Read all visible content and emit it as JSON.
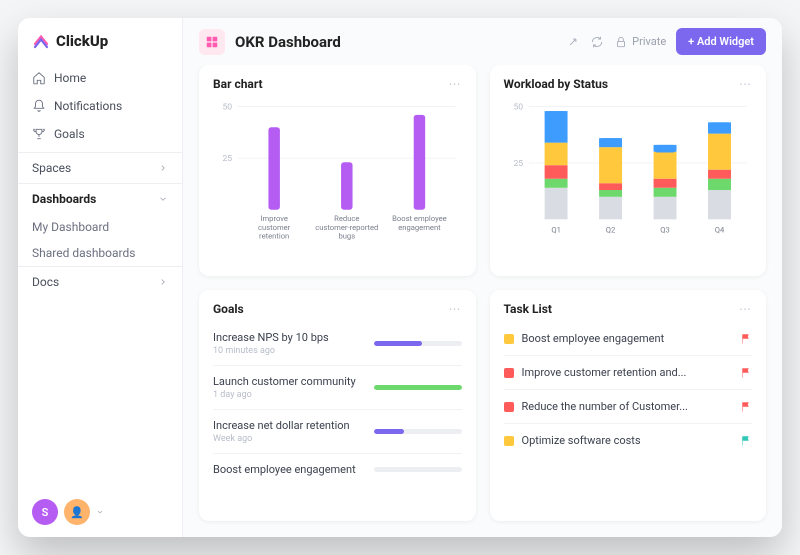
{
  "brand": "ClickUp",
  "nav": {
    "home": "Home",
    "notifications": "Notifications",
    "goals": "Goals"
  },
  "sections": {
    "spaces": "Spaces",
    "dashboards": "Dashboards",
    "my_dashboard": "My Dashboard",
    "shared_dashboards": "Shared dashboards",
    "docs": "Docs"
  },
  "header": {
    "title": "OKR Dashboard",
    "private": "Private",
    "add_widget": "+ Add Widget"
  },
  "cards": {
    "bar_chart": {
      "title": "Bar chart"
    },
    "workload": {
      "title": "Workload by Status"
    },
    "goals": {
      "title": "Goals"
    },
    "task_list": {
      "title": "Task List"
    }
  },
  "chart_data": [
    {
      "type": "bar",
      "title": "Bar chart",
      "categories": [
        "Improve customer retention",
        "Reduce customer-reported bugs",
        "Boost employee engagement"
      ],
      "values": [
        40,
        23,
        46
      ],
      "ylim": [
        0,
        50
      ],
      "yticks": [
        25,
        50
      ],
      "color": "#b55df2"
    },
    {
      "type": "stacked-bar",
      "title": "Workload by Status",
      "categories": [
        "Q1",
        "Q2",
        "Q3",
        "Q4"
      ],
      "series": [
        {
          "name": "none",
          "color": "#d9dce3",
          "values": [
            14,
            10,
            10,
            13
          ]
        },
        {
          "name": "green",
          "color": "#6dd96d",
          "values": [
            4,
            3,
            4,
            5
          ]
        },
        {
          "name": "red",
          "color": "#ff5b5b",
          "values": [
            6,
            3,
            4,
            4
          ]
        },
        {
          "name": "yellow",
          "color": "#ffc83d",
          "values": [
            10,
            16,
            12,
            16
          ]
        },
        {
          "name": "blue",
          "color": "#3e9cff",
          "values": [
            14,
            4,
            3,
            5
          ]
        }
      ],
      "ylim": [
        0,
        50
      ],
      "yticks": [
        25,
        50
      ]
    }
  ],
  "goals": [
    {
      "name": "Increase NPS by 10 bps",
      "meta": "10 minutes ago",
      "pct": 55,
      "color": "#7b68ee"
    },
    {
      "name": "Launch customer community",
      "meta": "1 day ago",
      "pct": 100,
      "color": "#6dd96d"
    },
    {
      "name": "Increase net dollar retention",
      "meta": "Week ago",
      "pct": 35,
      "color": "#7b68ee"
    },
    {
      "name": "Boost employee engagement",
      "meta": "",
      "pct": 0,
      "color": "#7b68ee"
    }
  ],
  "tasks": [
    {
      "name": "Boost employee engagement",
      "status": "#ffc83d",
      "flag": "#ff5b5b"
    },
    {
      "name": "Improve customer retention and...",
      "status": "#ff5b5b",
      "flag": "#ff5b5b"
    },
    {
      "name": "Reduce the number of Customer...",
      "status": "#ff5b5b",
      "flag": "#ff5b5b"
    },
    {
      "name": "Optimize software costs",
      "status": "#ffc83d",
      "flag": "#2ec7b6"
    }
  ]
}
